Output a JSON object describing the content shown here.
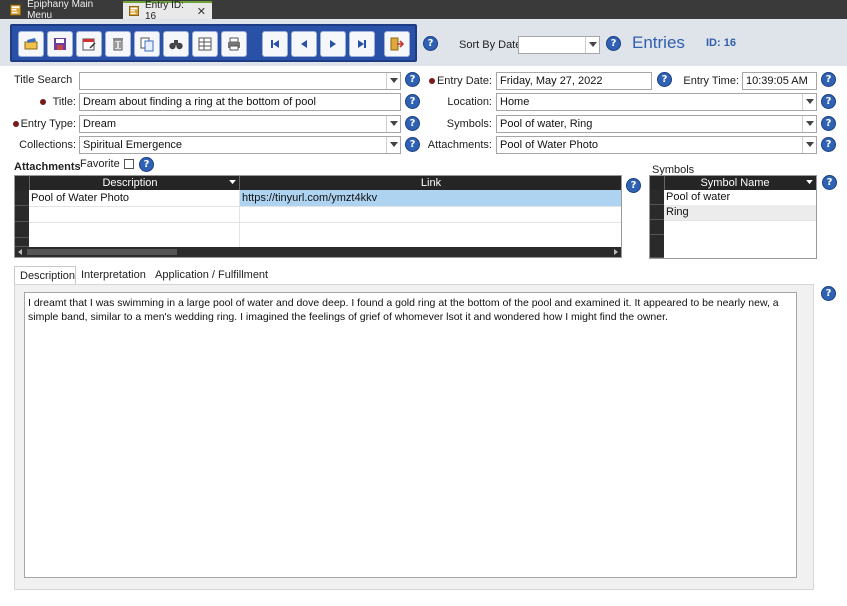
{
  "tabs": [
    {
      "label": "Epiphany Main Menu",
      "active": false
    },
    {
      "label": "Entry ID: 16",
      "active": true
    }
  ],
  "header": {
    "sort_label": "Sort By Date",
    "sort_value": "",
    "title": "Entries",
    "id_label": "ID: 16"
  },
  "toolbar": {
    "buttons": [
      "new-record-icon",
      "save-icon",
      "calendar-edit-icon",
      "delete-icon",
      "copy-icon",
      "find-icon",
      "table-icon",
      "print-icon"
    ],
    "nav": [
      "first-record-icon",
      "previous-record-icon",
      "next-record-icon",
      "last-record-icon"
    ],
    "exit": "exit-icon"
  },
  "form": {
    "title_search": {
      "label": "Title Search",
      "value": ""
    },
    "title": {
      "label": "Title:",
      "value": "Dream about finding a ring at the bottom of pool"
    },
    "entry_type": {
      "label": "Entry Type:",
      "value": "Dream"
    },
    "collections": {
      "label": "Collections:",
      "value": "Spiritual Emergence"
    },
    "entry_date": {
      "label": "Entry Date:",
      "value": "Friday, May 27, 2022"
    },
    "entry_time": {
      "label": "Entry Time:",
      "value": "10:39:05 AM"
    },
    "location": {
      "label": "Location:",
      "value": "Home"
    },
    "symbols": {
      "label": "Symbols:",
      "value": "Pool of water, Ring"
    },
    "attachments": {
      "label": "Attachments:",
      "value": "Pool of Water Photo"
    }
  },
  "attachments_grid": {
    "section_label": "Attachments",
    "favorite_label": "Favorite",
    "favorite_checked": false,
    "columns": [
      "Description",
      "Link"
    ],
    "rows": [
      {
        "description": "Pool of Water Photo",
        "link": "https://tinyurl.com/ymzt4kkv"
      }
    ]
  },
  "symbols_grid": {
    "section_label": "Symbols",
    "column": "Symbol Name",
    "rows": [
      "Pool of water",
      "Ring"
    ]
  },
  "bottom_tabs": [
    "Description",
    "Interpretation",
    "Application / Fulfillment"
  ],
  "description_text": "I dreamt that I was swimming in a large pool of water and dove deep. I found a gold ring at the bottom of the pool and examined it. It appeared to be nearly new, a simple band, similar to a men's wedding ring.  I imagined the feelings of grief of whomever lsot it  and wondered how I might find the owner.",
  "colors": {
    "toolbar": "#2a51a8",
    "accent_text": "#2f5fae",
    "required_bullet": "#7a1a1a",
    "link_row_highlight": "#aed3f1",
    "grid_header": "#252525"
  }
}
